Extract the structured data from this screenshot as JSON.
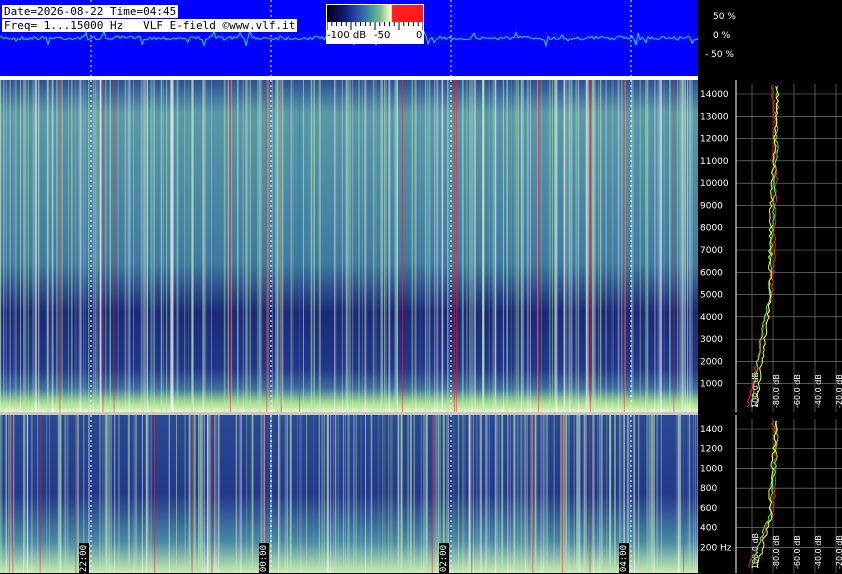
{
  "header": {
    "date_line": "Date=2026-08-22 Time=04:45",
    "freq_line": "Freq= 1...15000 Hz   VLF E-field ©www.vlf.it"
  },
  "colorbar": {
    "label_min": "-100 dB",
    "label_mid": "-50",
    "label_max": "0"
  },
  "amplitude_scale": {
    "top": "50 %",
    "mid": "0 %",
    "bottom": "- 50 %"
  },
  "upper_spectrum": {
    "freq_labels": [
      "14000",
      "13000",
      "12000",
      "11000",
      "10000",
      "9000",
      "8000",
      "7000",
      "6000",
      "5000",
      "4000",
      "3000",
      "2000",
      "1000"
    ],
    "db_labels": [
      "100.0 dB",
      "-80.0 dB",
      "-60.0 dB",
      "-40.0 dB",
      "-20.0 dB"
    ]
  },
  "lower_spectrum": {
    "freq_labels": [
      "1400",
      "1200",
      "1000",
      "800",
      "600",
      "400",
      "200 Hz"
    ],
    "db_labels": [
      "100.0 dB",
      "-80.0 dB",
      "-60.0 dB",
      "-40.0 dB",
      "-20.0 dB"
    ]
  },
  "time_markers": [
    "22:00",
    "00:00",
    "02:00",
    "04:00"
  ],
  "colors": {
    "waveform_bg": "#0000ff",
    "waveform_trace": "#00e5ff",
    "spectrum_low": "#1b2a78",
    "spectrum_high": "#8fd08a",
    "curve_red": "#ff2020",
    "curve_green": "#40ff40",
    "curve_yellow": "#ffff40"
  }
}
